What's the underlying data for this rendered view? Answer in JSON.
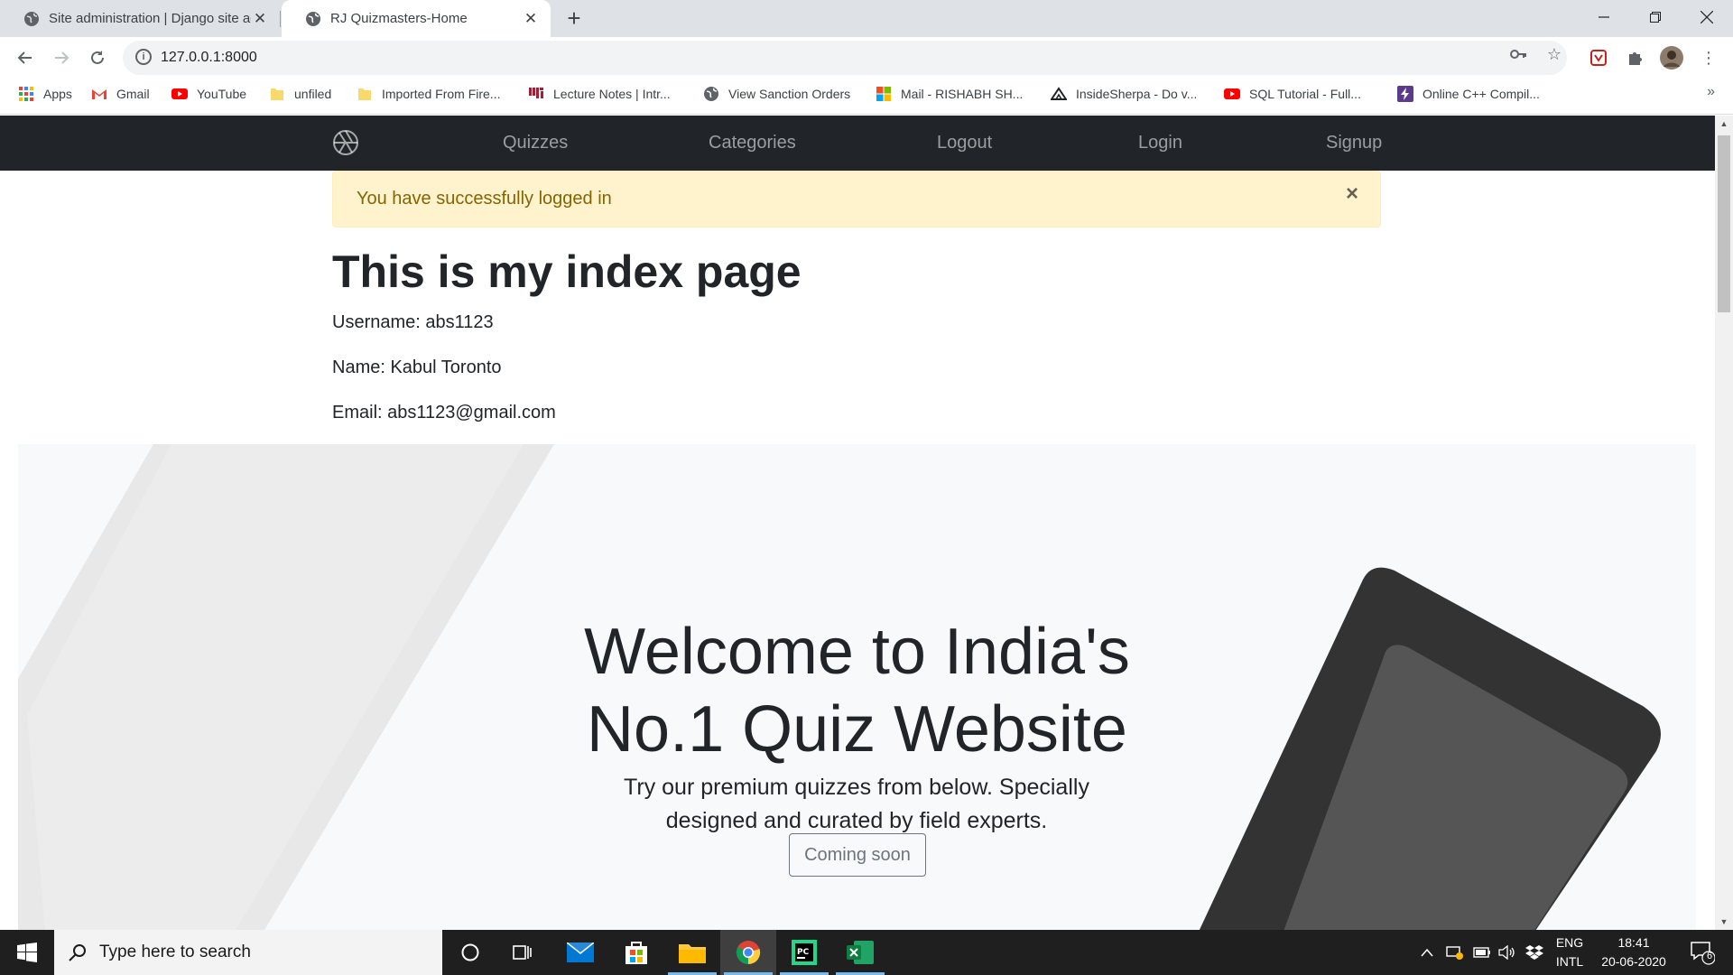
{
  "browser": {
    "tabs": [
      {
        "title": "Site administration | Django site admin",
        "active": false
      },
      {
        "title": "RJ Quizmasters-Home",
        "active": true
      }
    ],
    "new_tab_symbol": "+",
    "url": "127.0.0.1:8000",
    "bookmarks": [
      {
        "label": "Apps",
        "icon": "apps-grid-icon"
      },
      {
        "label": "Gmail",
        "icon": "gmail-icon"
      },
      {
        "label": "YouTube",
        "icon": "youtube-icon"
      },
      {
        "label": "unfiled",
        "icon": "folder-icon"
      },
      {
        "label": "Imported From Fire...",
        "icon": "folder-icon"
      },
      {
        "label": "Lecture Notes | Intr...",
        "icon": "mit-icon"
      },
      {
        "label": "View Sanction Orders",
        "icon": "globe-icon"
      },
      {
        "label": "Mail - RISHABH SH...",
        "icon": "microsoft-icon"
      },
      {
        "label": "InsideSherpa - Do v...",
        "icon": "insidesherpa-icon"
      },
      {
        "label": "SQL Tutorial - Full...",
        "icon": "youtube-icon"
      },
      {
        "label": "Online C++ Compil...",
        "icon": "bolt-icon"
      }
    ],
    "overflow_symbol": "»"
  },
  "site": {
    "nav": {
      "links": [
        "Quizzes",
        "Categories",
        "Logout",
        "Login",
        "Signup"
      ]
    },
    "alert": {
      "message": "You have successfully logged in",
      "close": "×"
    },
    "heading": "This is my index page",
    "user": {
      "username_line": "Username: abs1123",
      "name_line": "Name: Kabul Toronto",
      "email_line": "Email: abs1123@gmail.com"
    },
    "hero": {
      "title_line1": "Welcome to India's",
      "title_line2": "No.1 Quiz Website",
      "lead_line1": "Try our premium quizzes from below. Specially",
      "lead_line2": "designed and curated by field experts.",
      "button": "Coming soon"
    }
  },
  "taskbar": {
    "search_placeholder": "Type here to search",
    "language_line1": "ENG",
    "language_line2": "INTL",
    "time": "18:41",
    "date": "20-06-2020",
    "notification_count": "6"
  },
  "colors": {
    "navbar": "#212529",
    "alert_bg": "#fff3cd",
    "alert_text": "#856404",
    "hero_bg": "#f8f9fa",
    "taskbar": "#1f1f1f"
  }
}
